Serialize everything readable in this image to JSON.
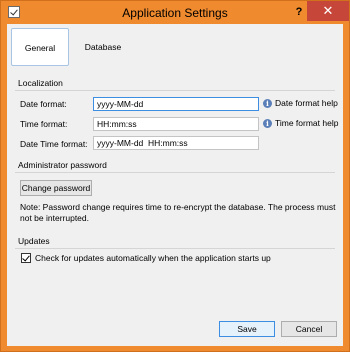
{
  "window": {
    "title": "Application Settings",
    "help": "?",
    "close": "✕"
  },
  "tabs": [
    {
      "label": "General"
    },
    {
      "label": "Database"
    }
  ],
  "localization": {
    "heading": "Localization",
    "date_label": "Date format:",
    "date_value": "yyyy-MM-dd",
    "date_help": "Date format help",
    "time_label": "Time format:",
    "time_value": "HH:mm:ss",
    "time_help": "Time format help",
    "datetime_label": "Date Time format:",
    "datetime_value": "yyyy-MM-dd  HH:mm:ss"
  },
  "admin": {
    "heading": "Administrator password",
    "change_button": "Change password",
    "note": "Note: Password change requires time to re-encrypt the database. The process must not be interrupted."
  },
  "updates": {
    "heading": "Updates",
    "checkbox_label": "Check for updates automatically when the application starts up",
    "checked": true
  },
  "footer": {
    "save_label": "Save",
    "cancel_label": "Cancel"
  },
  "colors": {
    "title_bar": "#ef8a2e",
    "close_button": "#c7463a",
    "focus_border": "#3d8ee2"
  },
  "icons": {
    "app": "checkbox-icon",
    "help": "info-icon"
  }
}
